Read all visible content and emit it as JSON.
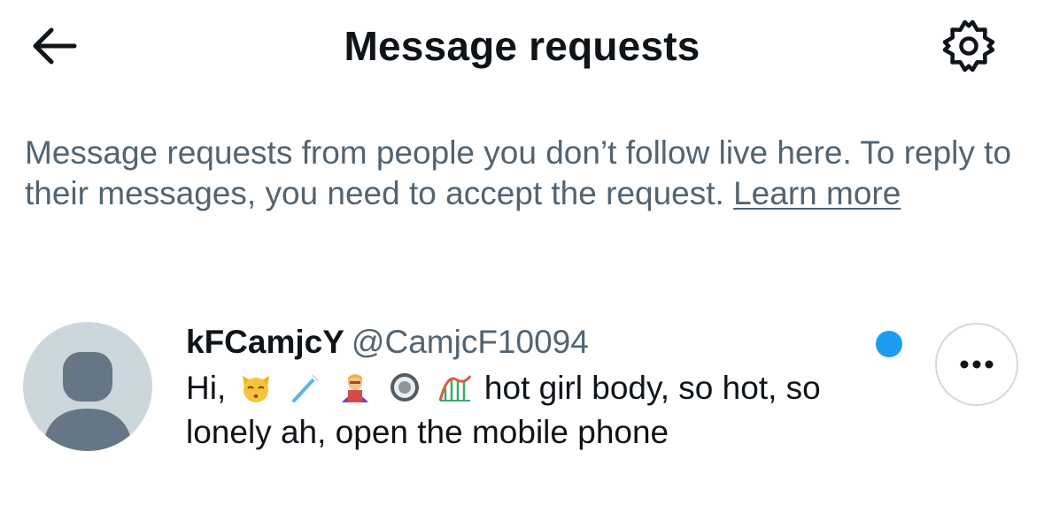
{
  "header": {
    "title": "Message requests",
    "back_icon": "arrow-left-icon",
    "settings_icon": "gear-icon"
  },
  "info": {
    "text": "Message requests from people you don’t follow live here. To reply to their messages, you need to accept the request.",
    "link_label": "Learn more"
  },
  "requests": [
    {
      "display_name": "kFCamjcY",
      "handle": "@CamjcF10094",
      "preview_start": "Hi,",
      "emojis": [
        "kissing-cat-icon",
        "toothbrush-icon",
        "woman-superhero-icon",
        "radio-button-icon",
        "roller-coaster-icon"
      ],
      "preview_rest": "hot girl body, so hot, so lonely ah, open the mobile phone",
      "unread": true,
      "more_icon": "more-horizontal-icon"
    }
  ],
  "colors": {
    "text_primary": "#0f1419",
    "text_secondary": "#536471",
    "accent_blue": "#1d9bf0",
    "avatar_bg": "#ccd6dd",
    "avatar_fg": "#657786",
    "border": "#cfd9de"
  }
}
